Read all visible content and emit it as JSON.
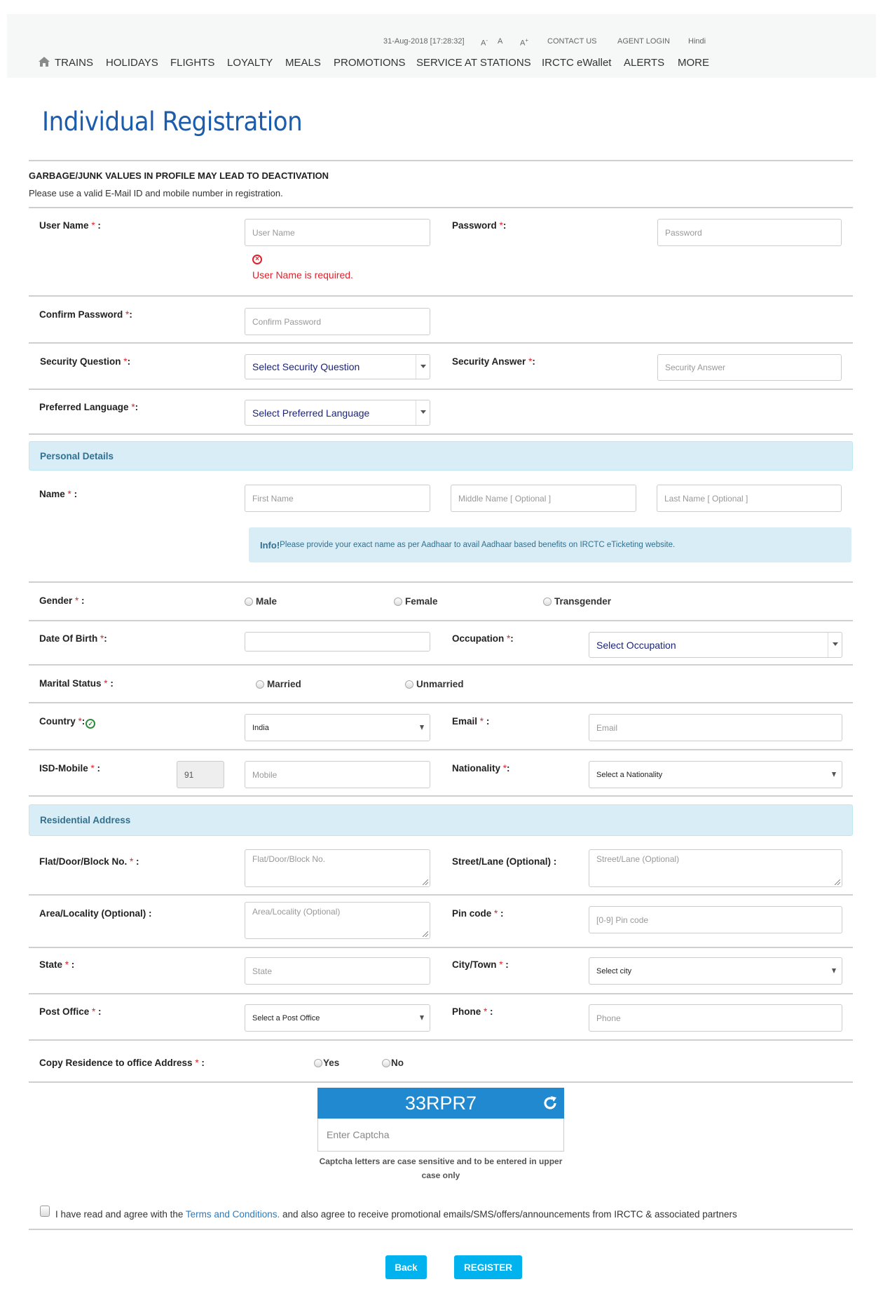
{
  "header": {
    "datetime": "31-Aug-2018 [17:28:32]",
    "font_small": "A",
    "font_small_sup": "-",
    "font_normal": "A",
    "font_large": "A",
    "font_large_sup": "+",
    "contact_us": "CONTACT US",
    "agent_login": "AGENT LOGIN",
    "language": "Hindi",
    "nav": [
      "TRAINS",
      "HOLIDAYS",
      "FLIGHTS",
      "LOYALTY",
      "MEALS",
      "PROMOTIONS",
      "SERVICE AT STATIONS",
      "IRCTC eWallet",
      "ALERTS",
      "MORE"
    ]
  },
  "page": {
    "title": "Individual Registration",
    "warning_title": "GARBAGE/JUNK VALUES IN PROFILE MAY LEAD TO DEACTIVATION",
    "warning_text": "Please use a valid E-Mail ID and mobile number in registration."
  },
  "req": "*",
  "form": {
    "username": {
      "label": "User Name",
      "suffix": " :",
      "placeholder": "User Name",
      "error": "User Name is required."
    },
    "password": {
      "label": "Password",
      "suffix": ":",
      "placeholder": "Password"
    },
    "confirm_password": {
      "label": "Confirm Password",
      "suffix": ":",
      "placeholder": "Confirm Password"
    },
    "security_question": {
      "label": "Security Question",
      "suffix": ":",
      "value": "Select Security Question"
    },
    "security_answer": {
      "label": "Security Answer",
      "suffix": ":",
      "placeholder": "Security Answer"
    },
    "preferred_language": {
      "label": "Preferred Language",
      "suffix": ":",
      "value": "Select Preferred Language"
    }
  },
  "personal": {
    "section_title": "Personal Details",
    "name": {
      "label": "Name",
      "suffix": " :",
      "first_placeholder": "First Name",
      "middle_placeholder": "Middle Name  [ Optional ]",
      "last_placeholder": "Last Name  [ Optional ]"
    },
    "info_strong": "Info!",
    "info_text": "Please provide your exact name as per Aadhaar to avail Aadhaar based benefits on IRCTC eTicketing website.",
    "gender": {
      "label": "Gender",
      "suffix": " :",
      "options": [
        "Male",
        "Female",
        "Transgender"
      ]
    },
    "dob": {
      "label": "Date Of Birth",
      "suffix": ":",
      "value": ""
    },
    "occupation": {
      "label": "Occupation",
      "suffix": ":",
      "value": "Select Occupation"
    },
    "marital": {
      "label": "Marital Status",
      "suffix": " :",
      "options": [
        "Married",
        "Unmarried"
      ]
    },
    "country": {
      "label": "Country",
      "suffix": ":",
      "value": "India"
    },
    "email": {
      "label": "Email",
      "suffix": " :",
      "placeholder": "Email"
    },
    "isd_mobile": {
      "label": "ISD-Mobile",
      "suffix": " :",
      "isd_value": "91",
      "mobile_placeholder": "Mobile"
    },
    "nationality": {
      "label": "Nationality",
      "suffix": ":",
      "value": "Select a Nationality"
    }
  },
  "address": {
    "section_title": "Residential Address",
    "flat": {
      "label": "Flat/Door/Block No.",
      "suffix": " :",
      "placeholder": "Flat/Door/Block No."
    },
    "street": {
      "label": "Street/Lane (Optional) :",
      "placeholder": "Street/Lane (Optional)"
    },
    "area": {
      "label": "Area/Locality (Optional) :",
      "placeholder": "Area/Locality (Optional)"
    },
    "pincode": {
      "label": "Pin code",
      "suffix": " :",
      "placeholder": "[0-9] Pin code"
    },
    "state": {
      "label": "State",
      "suffix": " :",
      "placeholder": "State"
    },
    "city": {
      "label": "City/Town",
      "suffix": " :",
      "value": "Select city"
    },
    "post_office": {
      "label": "Post Office",
      "suffix": " :",
      "value": "Select a Post Office"
    },
    "phone": {
      "label": "Phone",
      "suffix": " :",
      "placeholder": "Phone"
    },
    "copy_residence": {
      "label": "Copy Residence to office Address",
      "suffix": " :",
      "options": [
        "Yes",
        "No"
      ]
    }
  },
  "captcha": {
    "code": "33RPR7",
    "placeholder": "Enter Captcha",
    "note": "Captcha letters are case sensitive and to be entered in upper case only"
  },
  "agreement": {
    "prefix": "I have read and agree with the ",
    "link": "Terms and Conditions.",
    "suffix": " and also agree to receive promotional emails/SMS/offers/announcements from IRCTC & associated partners"
  },
  "buttons": {
    "back": "Back",
    "register": "REGISTER"
  },
  "colors": {
    "accent": "#00b2ee",
    "title": "#1c5cad",
    "error": "#e0202a",
    "captcha": "#2189cf",
    "band": "#d9edf7"
  }
}
